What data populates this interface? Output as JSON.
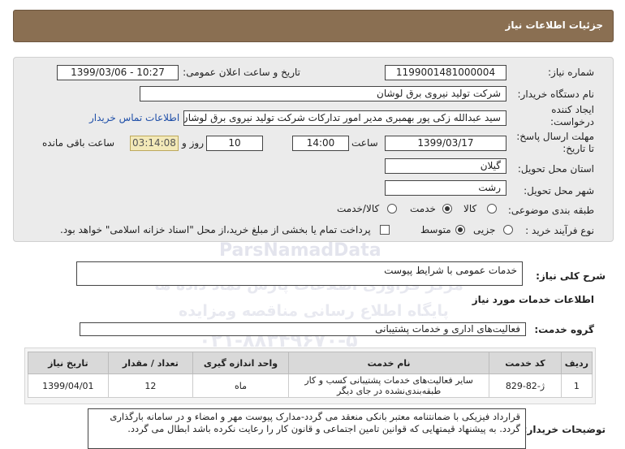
{
  "header": {
    "title": "جزئیات اطلاعات نیاز"
  },
  "form": {
    "need_number_label": "شماره نیاز:",
    "need_number": "1199001481000004",
    "announce_label": "تاریخ و ساعت اعلان عمومی:",
    "announce_value": "1399/03/06 - 10:27",
    "buyer_label": "نام دستگاه خریدار:",
    "buyer_value": "شرکت تولید نیروی برق لوشان",
    "creator_label_1": "ایجاد کننده",
    "creator_label_2": "درخواست:",
    "creator_value": "سید عبدالله زکی پور بهمبری مدیر امور تدارکات شرکت تولید نیروی برق لوشان",
    "contact_link": "اطلاعات تماس خریدار",
    "deadline_label_1": "مهلت ارسال پاسخ:",
    "deadline_label_2": "تا تاریخ:",
    "deadline_date": "1399/03/17",
    "time_label": "ساعت",
    "deadline_time": "14:00",
    "days_value": "10",
    "days_label": "روز و",
    "remaining_time": "03:14:08",
    "remaining_label": "ساعت باقی مانده",
    "province_label": "استان محل تحویل:",
    "province_value": "گیلان",
    "city_label": "شهر محل تحویل:",
    "city_value": "رشت",
    "category_label": "طبقه بندی موضوعی:",
    "category_options": [
      "کالا",
      "خدمت",
      "کالا/خدمت"
    ],
    "category_selected": "خدمت",
    "process_label": "نوع فرآیند خرید :",
    "process_options": [
      "جزیی",
      "متوسط"
    ],
    "process_selected": "متوسط",
    "payment_note": "پرداخت تمام یا بخشی از مبلغ خرید،از محل \"اسناد خزانه اسلامی\" خواهد بود."
  },
  "summary": {
    "label": "شرح کلی نیاز:",
    "value": "خدمات عمومی با شرایط پیوست"
  },
  "services": {
    "section_title": "اطلاعات خدمات مورد نیاز",
    "group_label": "گروه خدمت:",
    "group_value": "فعالیت‌های اداری و خدمات پشتیبانی"
  },
  "table": {
    "headers": [
      "ردیف",
      "کد خدمت",
      "نام خدمت",
      "واحد اندازه گیری",
      "تعداد / مقدار",
      "تاریخ نیاز"
    ],
    "rows": [
      {
        "row": "1",
        "code": "ژ-82-829",
        "name_1": "سایر فعالیت‌های خدمات پشتیبانی کسب و کار",
        "name_2": "طبقه‌بندی‌نشده در جای دیگر",
        "unit": "ماه",
        "qty": "12",
        "date": "1399/04/01"
      }
    ]
  },
  "notes": {
    "label": "توضیحات خریدار:",
    "text": "قرارداد فیزیکی با ضمانتنامه معتبر بانکی منعقد می گردد-مدارک پیوست مهر و امضاء و در سامانه بارگذاری گردد. به پیشنهاد قیمتهایی که قوانین تامین اجتماعی و قانون کار را رعایت نکرده باشد ابطال می گردد."
  },
  "watermark": {
    "brand": "ParsNamadData",
    "line1": "مرکز فراوری اطلاعات پارس نماد داده ها",
    "line2": "پایگاه اطلاع رسانی مناقصه ومزایده",
    "line3": "۰۲۱-۸۸۳۴۹۶۷۰-۵"
  },
  "colors": {
    "header_bg": "#8a6f52",
    "panel_bg": "#ebebeb",
    "link": "#1f4fa8",
    "timer_bg": "#f3e9b8"
  }
}
